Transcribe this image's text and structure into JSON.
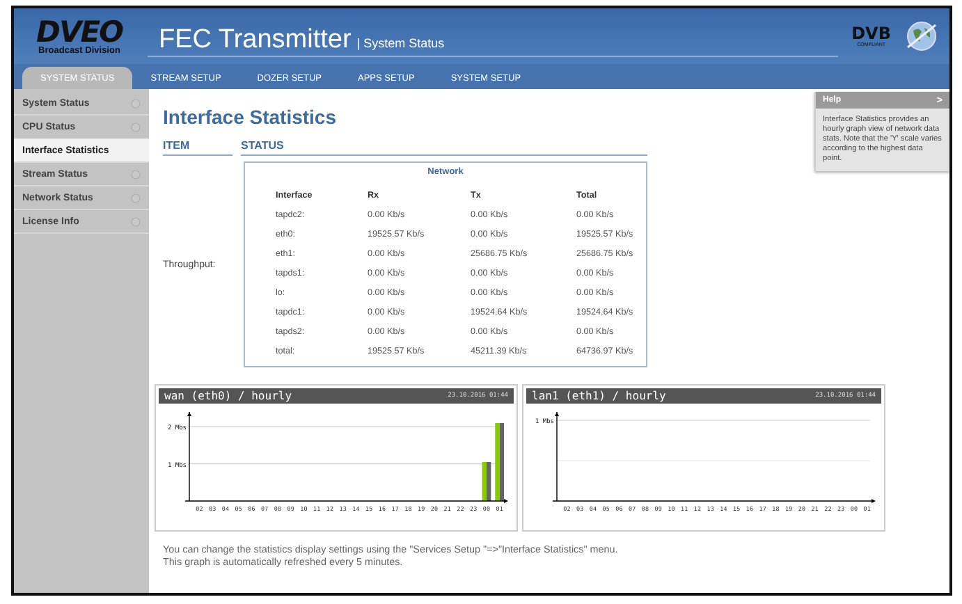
{
  "brand": {
    "logo": "DVEO",
    "tagline": "Broadcast Division",
    "title": "FEC Transmitter",
    "subtitle": "| System Status",
    "badge": "DVB",
    "badge_sub": "COMPLIANT"
  },
  "tabs": [
    {
      "label": "SYSTEM STATUS",
      "selected": true
    },
    {
      "label": "STREAM SETUP",
      "selected": false
    },
    {
      "label": "DOZER SETUP",
      "selected": false
    },
    {
      "label": "APPS SETUP",
      "selected": false
    },
    {
      "label": "SYSTEM SETUP",
      "selected": false
    }
  ],
  "sidebar": {
    "items": [
      {
        "label": "System Status",
        "selected": false
      },
      {
        "label": "CPU Status",
        "selected": false
      },
      {
        "label": "Interface Statistics",
        "selected": true
      },
      {
        "label": "Stream Status",
        "selected": false
      },
      {
        "label": "Network Status",
        "selected": false
      },
      {
        "label": "License Info",
        "selected": false
      }
    ]
  },
  "page_title": "Interface Statistics",
  "headers": [
    "ITEM",
    "STATUS"
  ],
  "item_label": "Throughput:",
  "table": {
    "title": "Network",
    "columns": [
      "Interface",
      "Rx",
      "Tx",
      "Total"
    ],
    "rows": [
      [
        "tapdc2:",
        "0.00 Kb/s",
        "0.00 Kb/s",
        "0.00 Kb/s"
      ],
      [
        "eth0:",
        "19525.57 Kb/s",
        "0.00 Kb/s",
        "19525.57 Kb/s"
      ],
      [
        "eth1:",
        "0.00 Kb/s",
        "25686.75 Kb/s",
        "25686.75 Kb/s"
      ],
      [
        "tapds1:",
        "0.00 Kb/s",
        "0.00 Kb/s",
        "0.00 Kb/s"
      ],
      [
        "lo:",
        "0.00 Kb/s",
        "0.00 Kb/s",
        "0.00 Kb/s"
      ],
      [
        "tapdc1:",
        "0.00 Kb/s",
        "19524.64 Kb/s",
        "19524.64 Kb/s"
      ],
      [
        "tapds2:",
        "0.00 Kb/s",
        "0.00 Kb/s",
        "0.00 Kb/s"
      ],
      [
        "total:",
        "19525.57 Kb/s",
        "45211.39 Kb/s",
        "64736.97 Kb/s"
      ]
    ]
  },
  "graphs": [
    {
      "timestamp": "23.10.2016 01:44",
      "chart_data": {
        "type": "bar",
        "title": "wan (eth0) / hourly",
        "categories": [
          "02",
          "03",
          "04",
          "05",
          "06",
          "07",
          "08",
          "09",
          "10",
          "11",
          "12",
          "13",
          "14",
          "15",
          "16",
          "17",
          "18",
          "19",
          "20",
          "21",
          "22",
          "23",
          "00",
          "01"
        ],
        "ylim": [
          0,
          2.4
        ],
        "yticks": [
          {
            "value": 1,
            "label": "1 Mbs"
          },
          {
            "value": 2,
            "label": "2 Mbs"
          }
        ],
        "series": [
          {
            "color": "#88cc00",
            "values": [
              0,
              0,
              0,
              0,
              0,
              0,
              0,
              0,
              0,
              0,
              0,
              0,
              0,
              0,
              0,
              0,
              0,
              0,
              0,
              0,
              0,
              0,
              1.05,
              2.1
            ]
          },
          {
            "color": "#666666",
            "values": [
              0,
              0,
              0,
              0,
              0,
              0,
              0,
              0,
              0,
              0,
              0,
              0,
              0,
              0,
              0,
              0,
              0,
              0,
              0,
              0,
              0,
              0,
              1.05,
              2.1
            ]
          }
        ]
      }
    },
    {
      "timestamp": "23.10.2016 01:44",
      "title": "lan1 (eth1) / hourly",
      "y_label": "1 Mbs",
      "hours": [
        "02",
        "03",
        "04",
        "05",
        "06",
        "07",
        "08",
        "09",
        "10",
        "11",
        "12",
        "13",
        "14",
        "15",
        "16",
        "17",
        "18",
        "19",
        "20",
        "21",
        "22",
        "23",
        "00",
        "01"
      ]
    }
  ],
  "footer": [
    "You can change the statistics display settings using the \"Services Setup \"=>\"Interface Statistics\" menu.",
    "This graph is automatically refreshed every 5 minutes."
  ],
  "help": {
    "title": "Help",
    "toggle": ">",
    "text": "Interface Statistics provides an hourly graph view of network data stats. Note that the 'Y' scale varies according to the highest data point."
  }
}
